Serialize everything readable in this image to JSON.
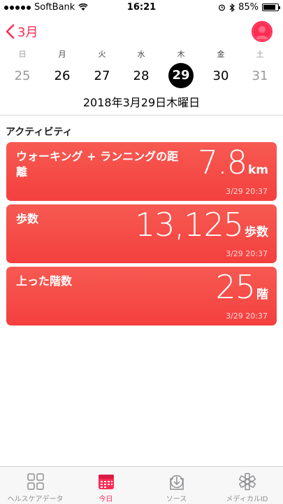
{
  "status": {
    "carrier": "SoftBank",
    "time": "16:21",
    "battery": "85%",
    "battery_level": 0.85
  },
  "nav": {
    "back_label": "3月",
    "back_icon": "chevron-left-icon",
    "profile_icon": "person-icon",
    "accent_color": "#ff2d55"
  },
  "week": {
    "days": [
      {
        "name": "日",
        "num": "25"
      },
      {
        "name": "月",
        "num": "26"
      },
      {
        "name": "火",
        "num": "27"
      },
      {
        "name": "水",
        "num": "28"
      },
      {
        "name": "木",
        "num": "29"
      },
      {
        "name": "金",
        "num": "30"
      },
      {
        "name": "土",
        "num": "31"
      }
    ],
    "selected_date": "2018年3月29日木曜日"
  },
  "activity": {
    "section_title": "アクティビティ",
    "card_color": "#f4403f",
    "cards": [
      {
        "title": "ウォーキング + ランニングの距\n離",
        "value": "7.8",
        "unit": "km",
        "time": "3/29 20:37"
      },
      {
        "title": "歩数",
        "value": "13,125",
        "unit": "歩数",
        "time": "3/29 20:37"
      },
      {
        "title": "上った階数",
        "value": "25",
        "unit": "階",
        "time": "3/29 20:37"
      }
    ]
  },
  "tabbar": {
    "tabs": [
      {
        "label": "ヘルスケアデータ",
        "icon": "grid-icon"
      },
      {
        "label": "今日",
        "icon": "calendar-icon"
      },
      {
        "label": "ソース",
        "icon": "download-icon"
      },
      {
        "label": "メディカルID",
        "icon": "asterisk-icon"
      }
    ],
    "active_tab": "今日"
  }
}
